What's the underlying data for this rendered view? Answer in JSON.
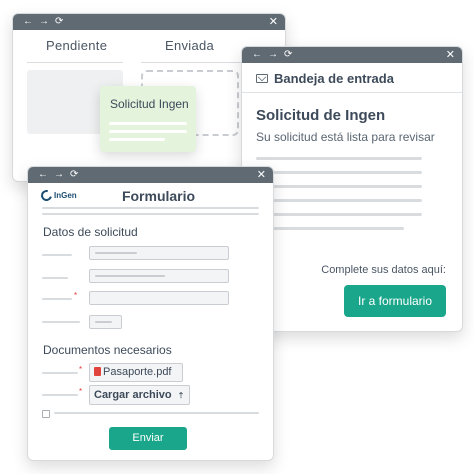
{
  "window_controls": {
    "back": "←",
    "forward": "→",
    "reload": "⟳",
    "close": "✕"
  },
  "status_board": {
    "tabs": [
      "Pendiente",
      "Enviada"
    ],
    "card_title": "Solicitud Ingen"
  },
  "inbox": {
    "title": "Bandeja de entrada",
    "subject": "Solicitud de Ingen",
    "preview": "Su solicitud está lista para revisar",
    "cta_text": "Complete sus datos aquí:",
    "cta_button": "Ir a formulario"
  },
  "form": {
    "logo_text": "InGen",
    "title": "Formulario",
    "section_request": "Datos de solicitud",
    "section_docs": "Documentos necesarios",
    "attached_file": "Pasaporte.pdf",
    "upload_button": "Cargar archivo",
    "submit_button": "Enviar"
  },
  "colors": {
    "accent": "#1aa68a",
    "titlebar": "#5f6a73",
    "card_green": "#e3f3dc",
    "required": "#e23b3b"
  }
}
